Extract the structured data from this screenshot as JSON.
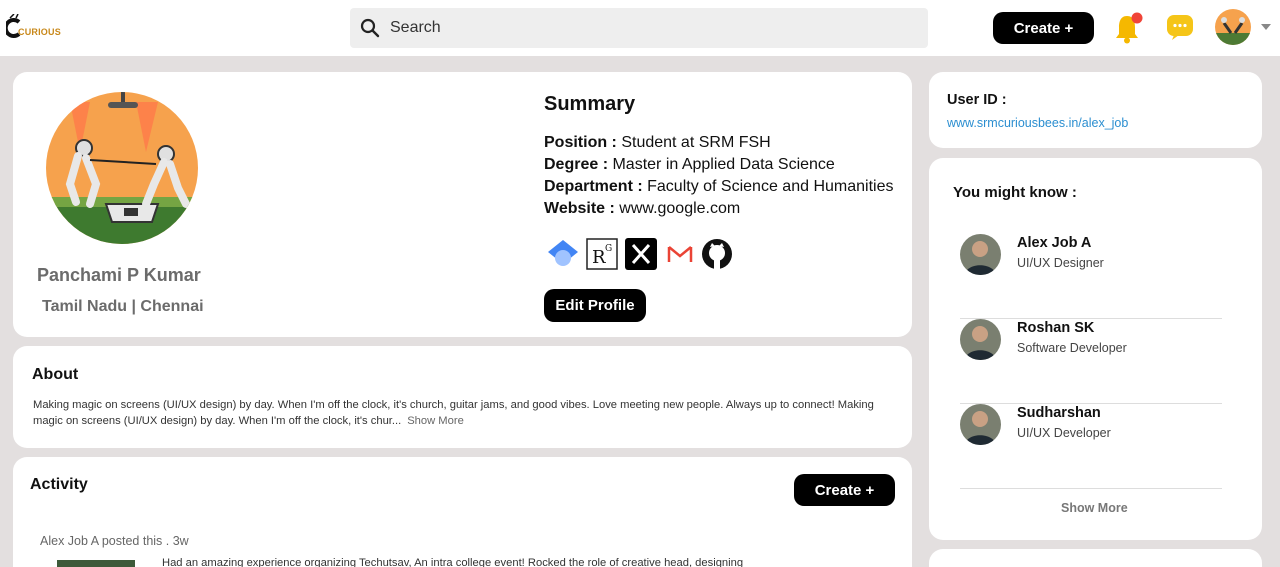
{
  "header": {
    "logo_text": "CURIOUS",
    "search_placeholder": "Search",
    "create_label": "Create +",
    "icons": [
      "search-icon",
      "bell-icon",
      "chat-icon",
      "avatar",
      "chevron-down-icon"
    ],
    "notification_color": "#f04438",
    "bell_color": "#f5b800",
    "chat_color": "#f5c518"
  },
  "profile": {
    "name": "Panchami P Kumar",
    "location": "Tamil Nadu | Chennai",
    "summary_title": "Summary",
    "rows": [
      {
        "label": "Position",
        "value": "Student at SRM FSH"
      },
      {
        "label": "Degree",
        "value": "Master in Applied Data Science"
      },
      {
        "label": "Department",
        "value": "Faculty of Science and Humanities"
      },
      {
        "label": "Website",
        "value": "www.google.com"
      }
    ],
    "social_icons": [
      "google-scholar-icon",
      "researchgate-icon",
      "x-icon",
      "gmail-icon",
      "github-icon"
    ],
    "edit_label": "Edit Profile"
  },
  "about": {
    "title": "About",
    "text": "Making magic on screens (UI/UX design) by day. When I'm off the clock, it's church, guitar jams, and good vibes. Love meeting new people. Always up to connect! Making magic on screens (UI/UX design) by day. When I'm off the clock, it's chur...",
    "show_more": "Show More"
  },
  "activity": {
    "title": "Activity",
    "create_label": "Create +",
    "post_meta": "Alex Job A posted this  . 3w",
    "post_text": "Had an amazing experience organizing Techutsav, An intra college event! Rocked the role of creative head, designing"
  },
  "sidebar": {
    "user_id_label": "User ID :",
    "user_id_link": "www.srmcuriousbees.in/alex_job",
    "might_know_title": "You might know :",
    "people": [
      {
        "name": "Alex Job A",
        "role": "UI/UX Designer"
      },
      {
        "name": "Roshan SK",
        "role": "Software Developer"
      },
      {
        "name": "Sudharshan",
        "role": "UI/UX Developer"
      }
    ],
    "show_more": "Show More"
  }
}
